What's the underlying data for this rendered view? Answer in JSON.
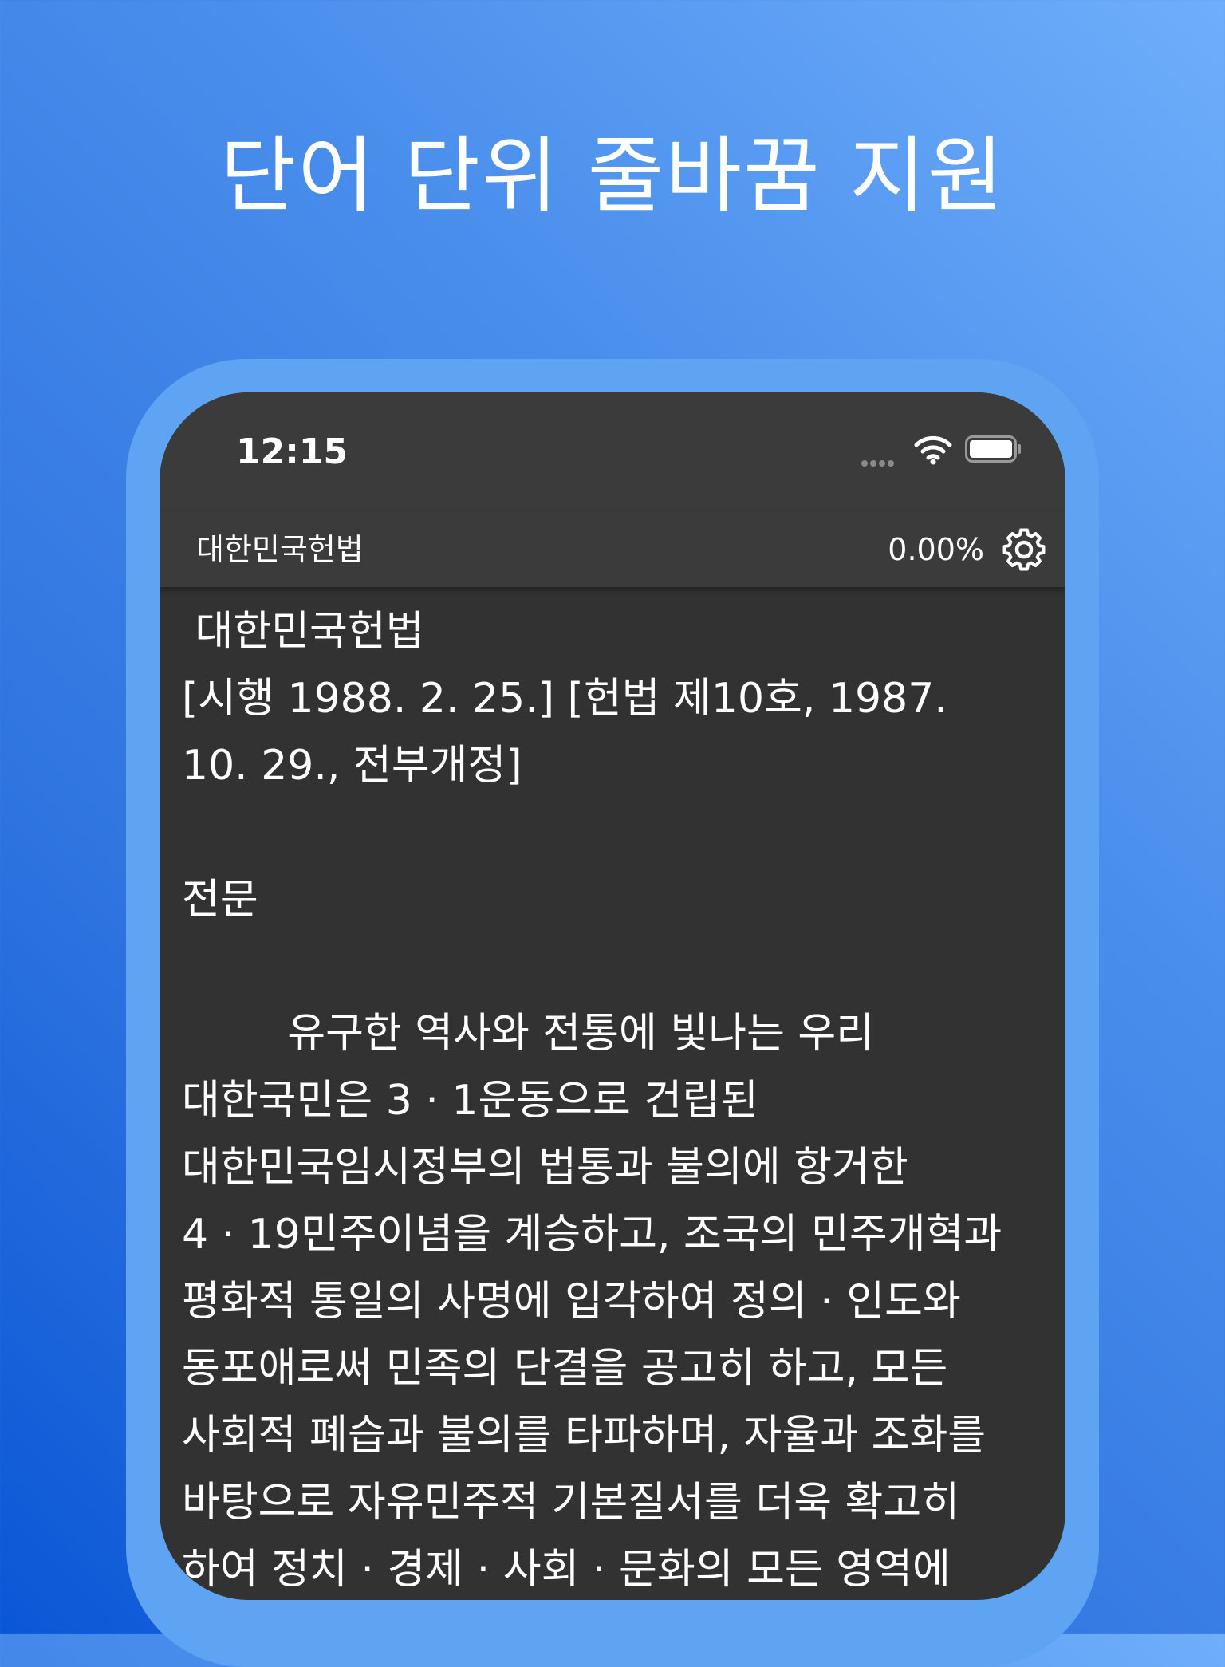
{
  "headline": "단어 단위 줄바꿈 지원",
  "status_bar": {
    "time": "12:15"
  },
  "nav": {
    "title": "대한민국헌법",
    "progress": "0.00%",
    "settings_icon": "gear-icon"
  },
  "content": {
    "title": " 대한민국헌법",
    "enforcement_line1": "[시행 1988. 2. 25.] [헌법 제10호, 1987.",
    "enforcement_line2": "10. 29., 전부개정]",
    "section": "전문",
    "lines": [
      "        유구한 역사와 전통에 빛나는 우리",
      "대한국민은 3 · 1운동으로 건립된",
      "대한민국임시정부의 법통과 불의에 항거한",
      "4 · 19민주이념을 계승하고, 조국의 민주개혁과",
      "평화적 통일의 사명에 입각하여 정의 · 인도와",
      "동포애로써 민족의 단결을 공고히 하고, 모든",
      "사회적 폐습과 불의를 타파하며, 자율과 조화를",
      "바탕으로 자유민주적 기본질서를 더욱 확고히",
      "하여 정치 · 경제 · 사회 · 문화의 모든 영역에"
    ]
  }
}
